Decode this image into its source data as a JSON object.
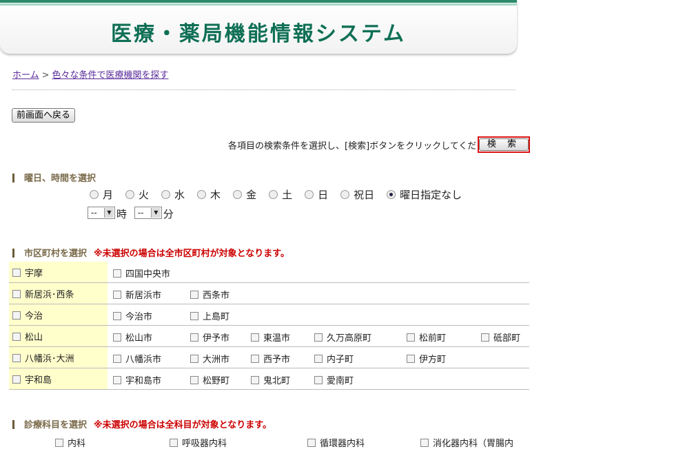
{
  "header": {
    "title": "医療・薬局機能情報システム"
  },
  "breadcrumb": {
    "home": "ホーム",
    "separator": ">",
    "current": "色々な条件で医療機関を探す"
  },
  "back_button": "前画面へ戻る",
  "instruction": "各項目の検索条件を選択し、[検索]ボタンをクリックしてください。→",
  "search_button": "検 索",
  "day_section": {
    "title": "曜日、時間を選択",
    "days": [
      "月",
      "火",
      "水",
      "木",
      "金",
      "土",
      "日",
      "祝日",
      "曜日指定なし"
    ],
    "selected_day": "曜日指定なし",
    "hour_value": "--",
    "hour_unit": "時",
    "minute_value": "--",
    "minute_unit": "分"
  },
  "municipality_section": {
    "title": "市区町村を選択",
    "note": "※未選択の場合は全市区町村が対象となります。",
    "rows": [
      {
        "area": "宇摩",
        "cities": [
          "四国中央市"
        ]
      },
      {
        "area": "新居浜･西条",
        "cities": [
          "新居浜市",
          "西条市"
        ]
      },
      {
        "area": "今治",
        "cities": [
          "今治市",
          "上島町"
        ]
      },
      {
        "area": "松山",
        "cities": [
          "松山市",
          "伊予市",
          "東温市",
          "久万高原町",
          "松前町",
          "砥部町"
        ]
      },
      {
        "area": "八幡浜･大洲",
        "cities": [
          "八幡浜市",
          "大洲市",
          "西予市",
          "内子町",
          "伊方町"
        ]
      },
      {
        "area": "宇和島",
        "cities": [
          "宇和島市",
          "松野町",
          "鬼北町",
          "愛南町"
        ]
      }
    ]
  },
  "department_section": {
    "title": "診療科目を選択",
    "note": "※未選択の場合は全科目が対象となります。",
    "items": [
      "内科",
      "呼吸器内科",
      "循環器内科",
      "消化器内科（胃腸内"
    ]
  }
}
